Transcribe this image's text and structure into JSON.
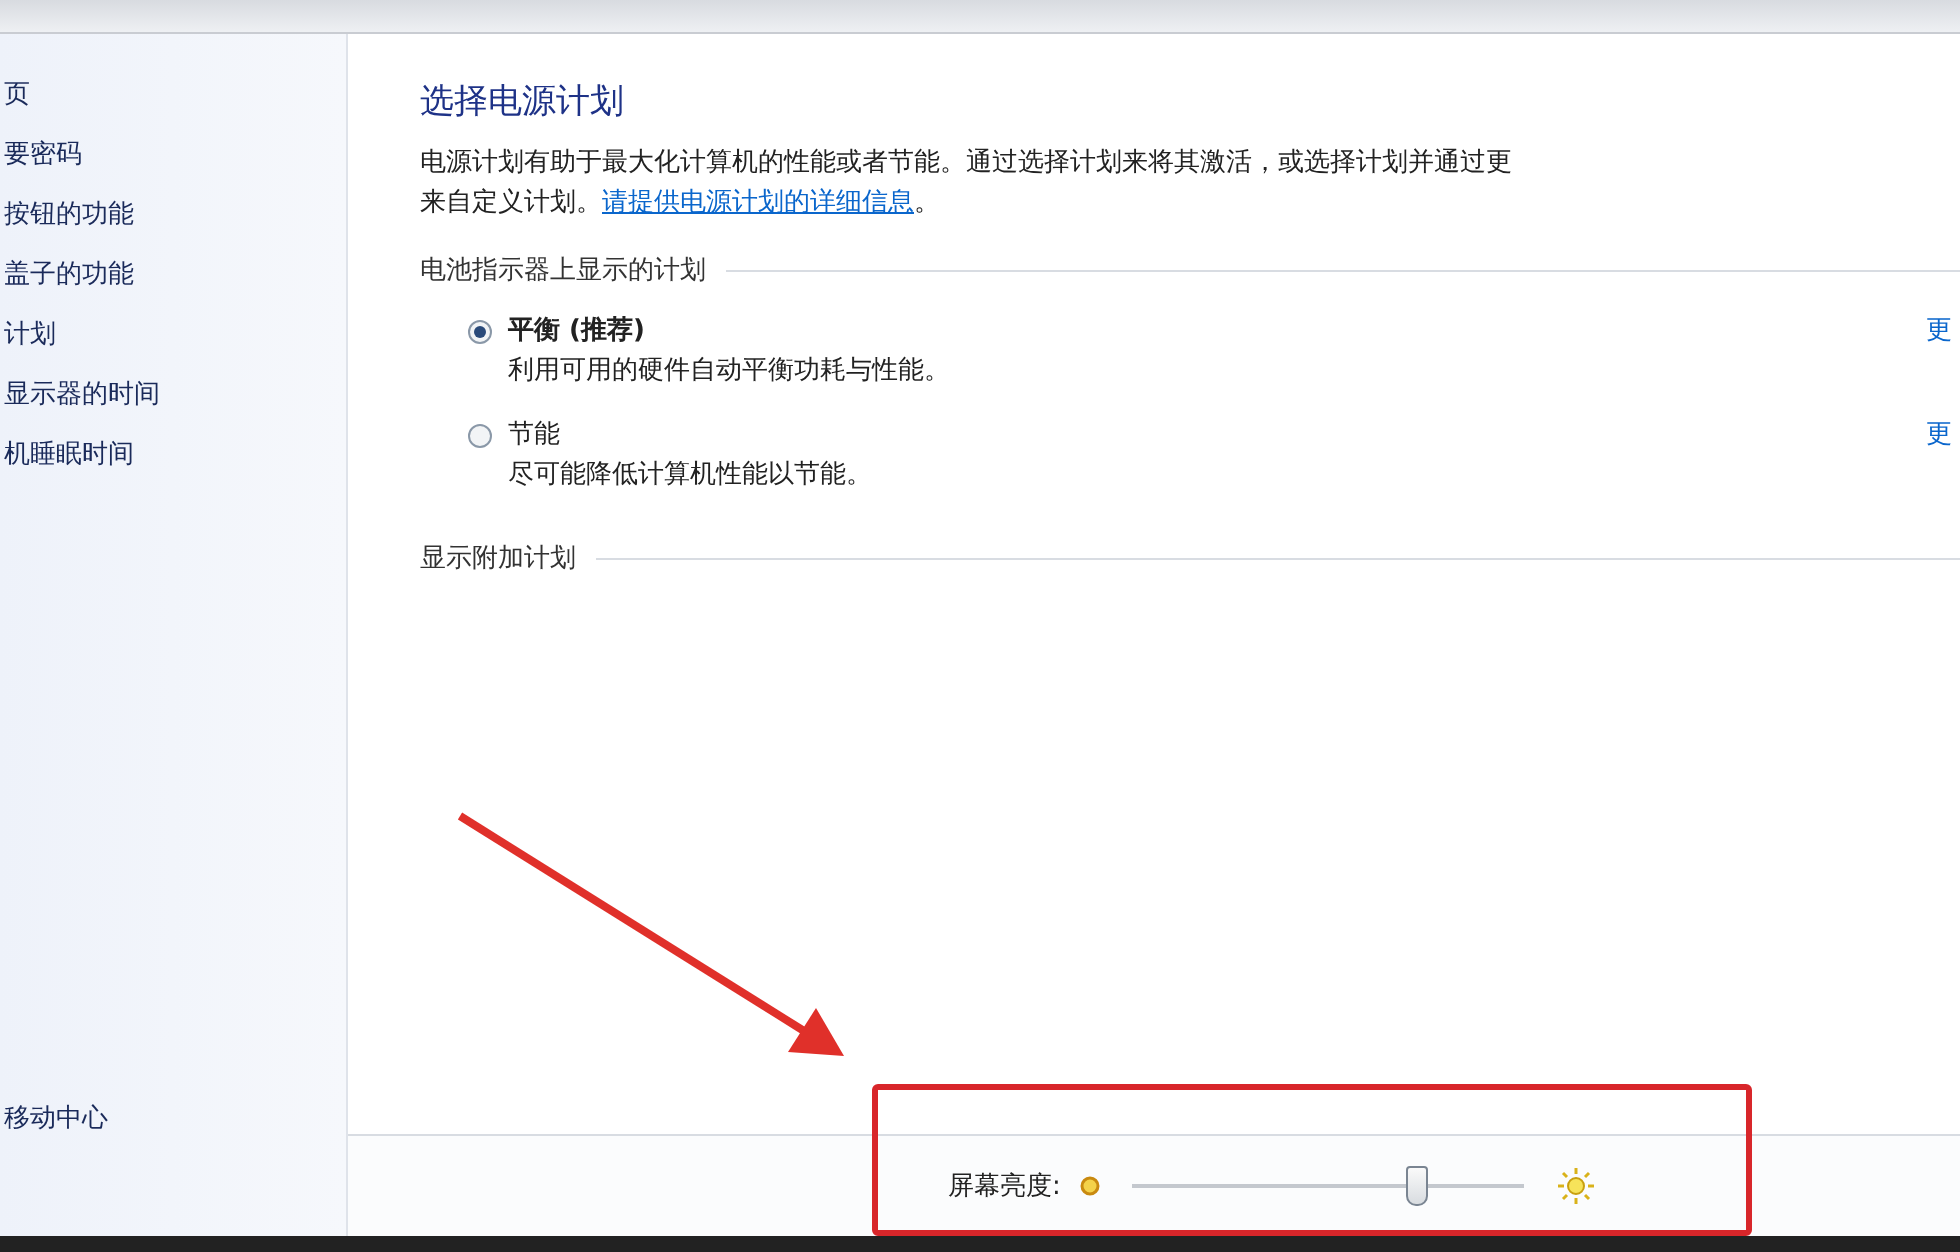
{
  "sidebar": {
    "items": [
      {
        "label": "页"
      },
      {
        "label": "要密码"
      },
      {
        "label": "按钮的功能"
      },
      {
        "label": "盖子的功能"
      },
      {
        "label": "计划"
      },
      {
        "label": "显示器的时间"
      },
      {
        "label": "机睡眠时间"
      }
    ],
    "footer_link": "移动中心"
  },
  "main": {
    "title": "选择电源计划",
    "description_line_1": "电源计划有助于最大化计算机的性能或者节能。通过选择计划来将其激活，或选择计划并通过更",
    "description_line_2": "来自定义计划。",
    "description_link": "请提供电源计划的详细信息",
    "description_end": "。",
    "section_title": "电池指示器上显示的计划",
    "plans": [
      {
        "name": "平衡 (推荐)",
        "description": "利用可用的硬件自动平衡功耗与性能。",
        "selected": true,
        "change_link": "更"
      },
      {
        "name": "节能",
        "description": "尽可能降低计算机性能以节能。",
        "selected": false,
        "change_link": "更"
      }
    ],
    "more_plans": "显示附加计划"
  },
  "brightness": {
    "label": "屏幕亮度:",
    "level": 0.72
  }
}
